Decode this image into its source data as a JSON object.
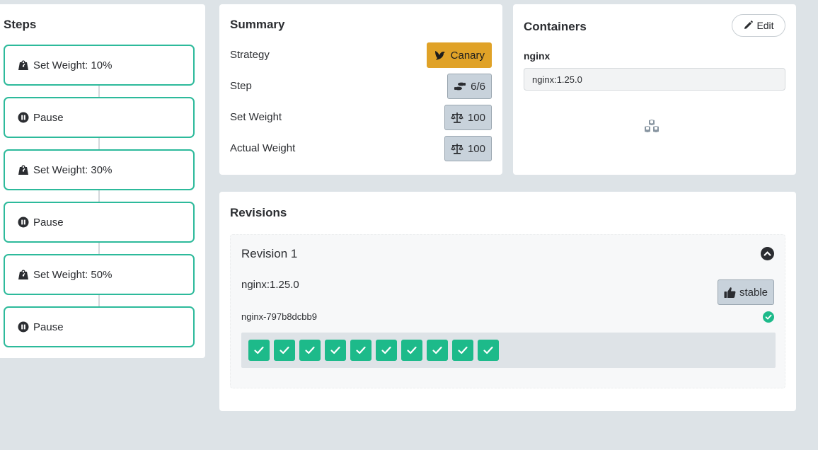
{
  "steps": {
    "title": "Steps",
    "items": [
      {
        "label": "Set Weight: 10%",
        "icon": "weight-icon"
      },
      {
        "label": "Pause",
        "icon": "pause-icon"
      },
      {
        "label": "Set Weight: 30%",
        "icon": "weight-icon"
      },
      {
        "label": "Pause",
        "icon": "pause-icon"
      },
      {
        "label": "Set Weight: 50%",
        "icon": "weight-icon"
      },
      {
        "label": "Pause",
        "icon": "pause-icon"
      }
    ]
  },
  "summary": {
    "title": "Summary",
    "rows": [
      {
        "label": "Strategy",
        "value": "Canary",
        "icon": "canary-bird-icon"
      },
      {
        "label": "Step",
        "value": "6/6",
        "icon": "shoe-prints-icon"
      },
      {
        "label": "Set Weight",
        "value": "100",
        "icon": "balance-scale-icon"
      },
      {
        "label": "Actual Weight",
        "value": "100",
        "icon": "balance-scale-icon"
      }
    ]
  },
  "containers": {
    "title": "Containers",
    "edit_label": "Edit",
    "container_name": "nginx",
    "image_value": "nginx:1.25.0",
    "icon": "cubes-icon"
  },
  "revisions": {
    "title": "Revisions",
    "items": [
      {
        "title": "Revision 1",
        "image": "nginx:1.25.0",
        "status_label": "stable",
        "replicaset": "nginx-797b8dcbb9",
        "pod_count": 10
      }
    ]
  },
  "colors": {
    "accent_teal": "#2dba9b",
    "canary_orange": "#e0a227",
    "pod_green": "#1dba8a",
    "badge_gray": "#c8d2db",
    "background": "#dde3e7"
  }
}
